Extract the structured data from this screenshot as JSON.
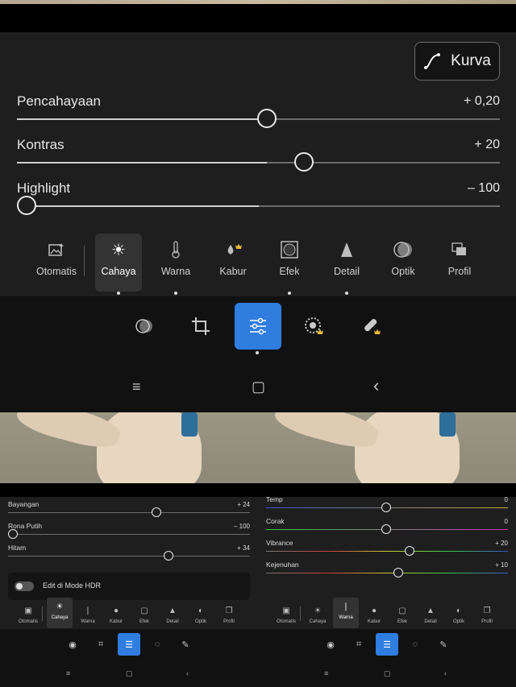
{
  "kurva_button": {
    "label": "Kurva"
  },
  "sliders": [
    {
      "label": "Pencahayaan",
      "value": "+ 0,20",
      "position": 0.52
    },
    {
      "label": "Kontras",
      "value": "+ 20",
      "position": 0.6
    },
    {
      "label": "Highlight",
      "value": "– 100",
      "position": 0.0
    }
  ],
  "tabs": [
    {
      "label": "Otomatis",
      "icon": "auto-image-icon"
    },
    {
      "label": "Cahaya",
      "icon": "sun-icon",
      "selected": true
    },
    {
      "label": "Warna",
      "icon": "thermometer-icon"
    },
    {
      "label": "Kabur",
      "icon": "drop-premium-icon"
    },
    {
      "label": "Efek",
      "icon": "vignette-icon"
    },
    {
      "label": "Detail",
      "icon": "triangle-icon"
    },
    {
      "label": "Optik",
      "icon": "lens-icon"
    },
    {
      "label": "Profil",
      "icon": "layers-icon"
    }
  ],
  "toolbar": {
    "items": [
      "presets-icon",
      "crop-icon",
      "adjust-icon",
      "masking-premium-icon",
      "heal-premium-icon"
    ],
    "selected_index": 2
  },
  "navbar": {
    "menu": "≡",
    "home": "▢",
    "back": "‹"
  },
  "left_panel": {
    "sliders": [
      {
        "label": "Bayangan",
        "value": "+ 24",
        "position": 0.62
      },
      {
        "label": "Rona Putih",
        "value": "– 100",
        "position": 0.0
      },
      {
        "label": "Hitam",
        "value": "+ 34",
        "position": 0.67
      }
    ],
    "hdr_label": "Edit di Mode HDR",
    "selected_tab": "Cahaya"
  },
  "right_panel": {
    "sliders": [
      {
        "label": "Temp",
        "value": "0",
        "position": 0.5
      },
      {
        "label": "Corak",
        "value": "0",
        "position": 0.5
      },
      {
        "label": "Vibrance",
        "value": "+ 20",
        "position": 0.6
      },
      {
        "label": "Kejenuhan",
        "value": "+ 10",
        "position": 0.55
      }
    ],
    "selected_tab": "Warna"
  },
  "colors": {
    "accent": "#2f7dde",
    "panel_bg": "#1e1e1e",
    "premium": "#e8b93a"
  }
}
